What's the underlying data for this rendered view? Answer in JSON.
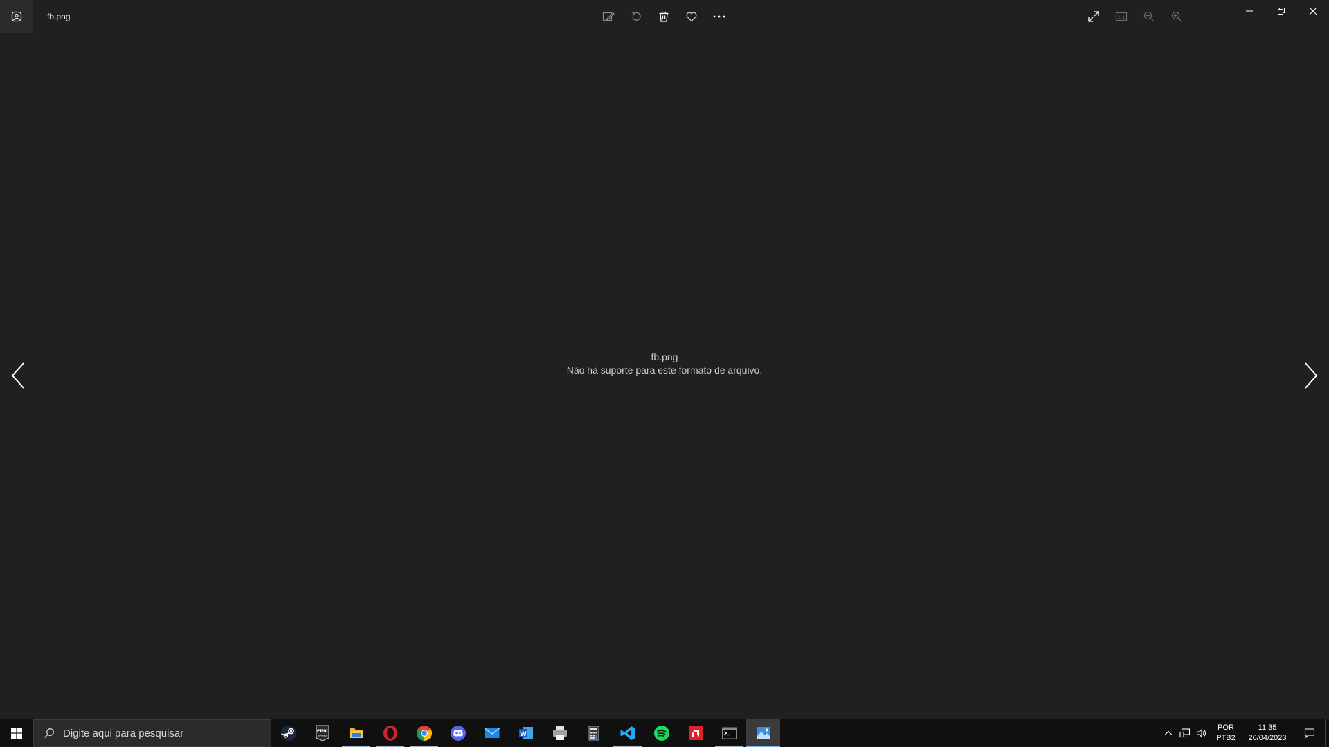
{
  "window": {
    "title": "fb.png",
    "app_icon": "photos-app-icon"
  },
  "toolbar": {
    "center": [
      {
        "name": "edit-image-button",
        "icon": "edit-icon"
      },
      {
        "name": "rotate-button",
        "icon": "rotate-icon"
      },
      {
        "name": "delete-button",
        "icon": "trash-icon"
      },
      {
        "name": "favorite-button",
        "icon": "heart-icon"
      },
      {
        "name": "more-options-button",
        "icon": "more-icon"
      }
    ],
    "right": [
      {
        "name": "fullscreen-button",
        "icon": "expand-icon"
      },
      {
        "name": "actual-size-button",
        "icon": "actual-size-icon",
        "label": "1:1"
      },
      {
        "name": "zoom-out-button",
        "icon": "zoom-out-icon"
      },
      {
        "name": "zoom-in-button",
        "icon": "zoom-in-icon"
      }
    ],
    "window_controls": [
      "minimize",
      "restore",
      "close"
    ]
  },
  "viewer": {
    "file_name": "fb.png",
    "error_message": "Não há suporte para este formato de arquivo."
  },
  "taskbar": {
    "search_placeholder": "Digite aqui para pesquisar",
    "apps": [
      {
        "name": "steam",
        "running": false
      },
      {
        "name": "epic-games",
        "label": "EPIC\nGAMES",
        "running": false
      },
      {
        "name": "file-explorer",
        "running": true
      },
      {
        "name": "opera",
        "running": true
      },
      {
        "name": "chrome",
        "running": true
      },
      {
        "name": "discord",
        "running": false
      },
      {
        "name": "mail",
        "running": false
      },
      {
        "name": "word",
        "label": "W",
        "running": false
      },
      {
        "name": "printer-app",
        "running": false
      },
      {
        "name": "calculator",
        "running": false
      },
      {
        "name": "vscode",
        "running": true
      },
      {
        "name": "spotify",
        "running": false
      },
      {
        "name": "amd-software",
        "running": false
      },
      {
        "name": "terminal",
        "running": true
      },
      {
        "name": "photos",
        "running": true,
        "active": true
      }
    ],
    "tray": {
      "lang_top": "POR",
      "lang_bottom": "PTB2",
      "time": "11:35",
      "date": "26/04/2023"
    }
  },
  "colors": {
    "background": "#202020",
    "taskbar": "#101010",
    "accent": "#7ab0e6"
  }
}
